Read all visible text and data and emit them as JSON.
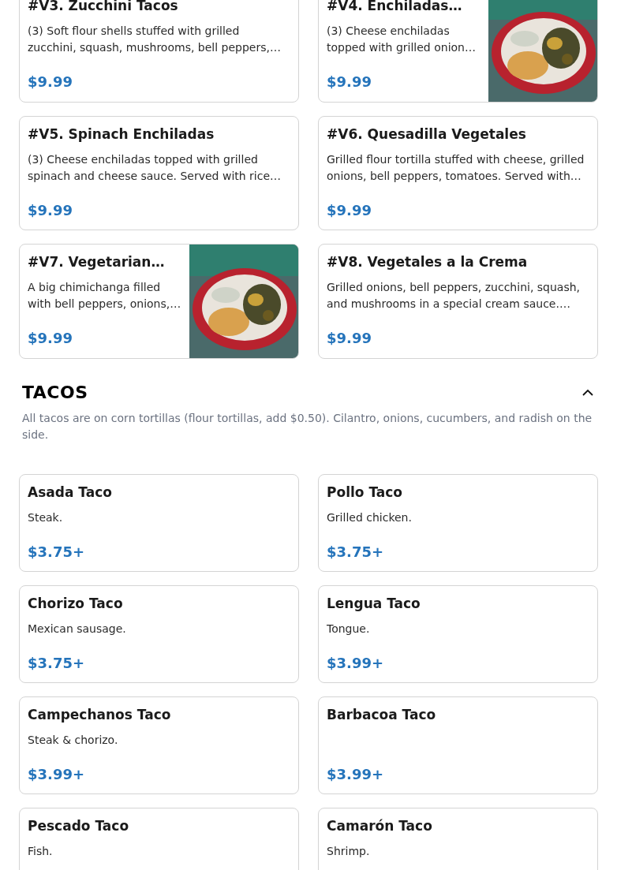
{
  "previous_items": [
    {
      "name": "#V3. Zucchini Tacos",
      "description": "(3) Soft flour shells stuffed with grilled zucchini, squash, mushrooms, bell peppers,…",
      "price": "$9.99",
      "photo": false
    },
    {
      "name": "#V4. Enchiladas…",
      "description": "(3) Cheese enchiladas topped with grilled onion…",
      "price": "$9.99",
      "photo": true
    },
    {
      "name": "#V5. Spinach Enchiladas",
      "description": "(3) Cheese enchiladas topped with grilled spinach and cheese sauce. Served with rice…",
      "price": "$9.99",
      "photo": false
    },
    {
      "name": "#V6. Quesadilla Vegetales",
      "description": "Grilled flour tortilla stuffed with cheese, grilled onions, bell peppers, tomatoes. Served with…",
      "price": "$9.99",
      "photo": false
    },
    {
      "name": "#V7. Vegetarian…",
      "description": "A big chimichanga filled with bell peppers, onions,…",
      "price": "$9.99",
      "photo": true
    },
    {
      "name": "#V8. Vegetales a la Crema",
      "description": "Grilled onions, bell peppers, zucchini, squash, and mushrooms in a special cream sauce.…",
      "price": "$9.99",
      "photo": false
    }
  ],
  "section": {
    "title": "TACOS",
    "expanded": true,
    "description": "All tacos are on corn tortillas (flour tortillas, add $0.50). Cilantro, onions, cucumbers, and radish on the side.",
    "items": [
      {
        "name": "Asada Taco",
        "description": "Steak.",
        "price": "$3.75+",
        "photo": false
      },
      {
        "name": "Pollo Taco",
        "description": "Grilled chicken.",
        "price": "$3.75+",
        "photo": false
      },
      {
        "name": "Chorizo Taco",
        "description": "Mexican sausage.",
        "price": "$3.75+",
        "photo": false
      },
      {
        "name": "Lengua Taco",
        "description": "Tongue.",
        "price": "$3.99+",
        "photo": false
      },
      {
        "name": "Campechanos Taco",
        "description": "Steak & chorizo.",
        "price": "$3.99+",
        "photo": false
      },
      {
        "name": "Barbacoa Taco",
        "price": "$3.99+",
        "photo": false
      },
      {
        "name": "Pescado Taco",
        "description": "Fish.",
        "photo": false
      },
      {
        "name": "Camarón Taco",
        "description": "Shrimp.",
        "photo": false
      }
    ]
  }
}
